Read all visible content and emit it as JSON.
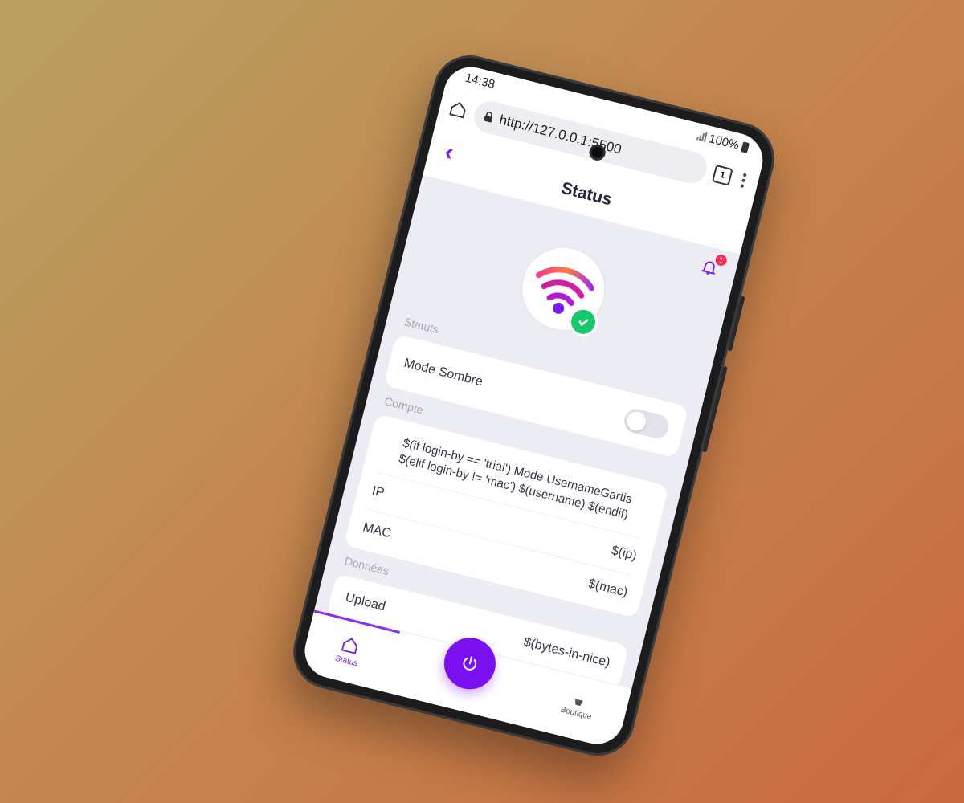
{
  "status_bar": {
    "time": "14:38",
    "battery": "100%"
  },
  "browser": {
    "url": "http://127.0.0.1:5500",
    "tabs_count": "1"
  },
  "app": {
    "title": "Status",
    "notification_count": "1",
    "sections": {
      "statuts": "Statuts",
      "compte": "Compte",
      "donnees": "Données"
    },
    "mode_sombre_label": "Mode Sombre",
    "mode_sombre_enabled": false,
    "username_text": "$(if login-by == 'trial') Mode UsernameGartis $(elif login-by != 'mac') $(username) $(endif)",
    "rows": {
      "ip_label": "IP",
      "ip_value": "$(ip)",
      "mac_label": "MAC",
      "mac_value": "$(mac)",
      "upload_label": "Upload",
      "upload_value": "$(bytes-in-nice)"
    },
    "nav": {
      "status_label": "Status",
      "boutique_label": "Boutique"
    }
  },
  "colors": {
    "accent": "#7a0ff0",
    "check": "#19c86a",
    "badge": "#ff2d55"
  },
  "icons": [
    "home-icon",
    "lock-icon",
    "bell-icon",
    "wifi-icon",
    "check-icon",
    "power-icon",
    "shop-icon"
  ]
}
